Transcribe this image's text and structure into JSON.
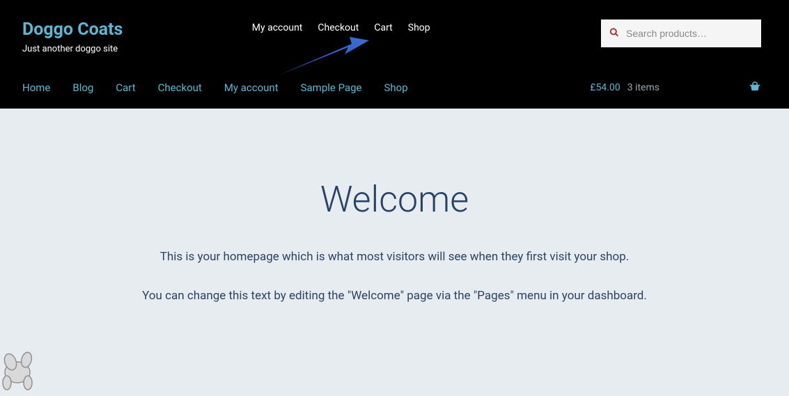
{
  "branding": {
    "title": "Doggo Coats",
    "tagline": "Just another doggo site"
  },
  "topNav": {
    "items": [
      {
        "label": "My account"
      },
      {
        "label": "Checkout"
      },
      {
        "label": "Cart"
      },
      {
        "label": "Shop"
      }
    ]
  },
  "search": {
    "placeholder": "Search products…"
  },
  "mainNav": {
    "items": [
      {
        "label": "Home"
      },
      {
        "label": "Blog"
      },
      {
        "label": "Cart"
      },
      {
        "label": "Checkout"
      },
      {
        "label": "My account"
      },
      {
        "label": "Sample Page"
      },
      {
        "label": "Shop"
      }
    ]
  },
  "cart": {
    "total": "£54.00",
    "itemsText": "3 items"
  },
  "content": {
    "heading": "Welcome",
    "line1": "This is your homepage which is what most visitors will see when they first visit your shop.",
    "line2": "You can change this text by editing the \"Welcome\" page via the \"Pages\" menu in your dashboard."
  }
}
